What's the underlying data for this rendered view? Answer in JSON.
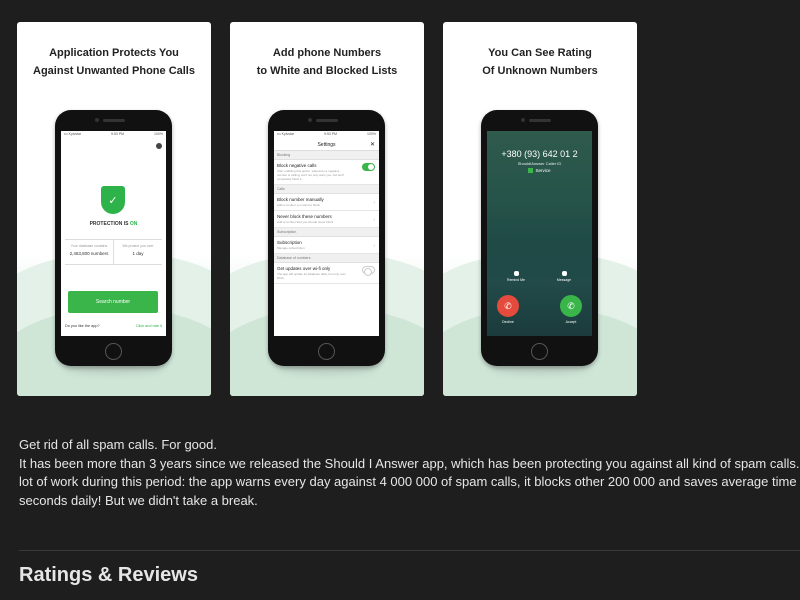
{
  "screenshots": [
    {
      "title_line1": "Application Protects You",
      "title_line2": "Against Unwanted Phone Calls",
      "status_left": "••• Kyivstar",
      "status_center": "9:53 PM",
      "status_right": "100%",
      "protection_label": "PROTECTION IS",
      "protection_state": "ON",
      "stat1_label": "Your database contains",
      "stat1_value": "2,463,800 numbers",
      "stat2_label": "We protect you over",
      "stat2_value": "1 day",
      "search_button": "Search number",
      "like_prompt": "Do you like the app?",
      "rate_link": "Click and rate it"
    },
    {
      "title_line1": "Add phone Numbers",
      "title_line2": "to White and Blocked Lists",
      "status_left": "••• Kyivstar",
      "status_center": "9:53 PM",
      "status_right": "100%",
      "nav_title": "Settings",
      "close": "✕",
      "sec_blocking": "Blocking",
      "block_negative": "Block negative calls",
      "block_negative_desc": "After enabling this option, whenever a negative number is calling, we'll not only warn you, but we'll completely block it.",
      "sec_calls": "Calls",
      "block_manual": "Block number manually",
      "block_manual_desc": "Add a number you want to block",
      "never_block": "Never block these numbers",
      "never_block_desc": "Add a number that you should never block",
      "sec_subscription": "Subscription",
      "subscription": "Subscription",
      "subscription_desc": "Manage subscription",
      "sec_database": "Database of numbers",
      "updates_wifi": "Get updates over wi-fi only",
      "updates_wifi_desc": "The app will update its database daily, but only over Wi-Fi"
    },
    {
      "title_line1": "You Can See Rating",
      "title_line2": "Of Unknown Numbers",
      "phone_number": "+380 (93) 642 01 2",
      "caller_id": "ShouldIAnswer Caller ID",
      "rating": "Service",
      "remind_me": "Remind Me",
      "message": "Message",
      "decline": "Decline",
      "accept": "Accept"
    }
  ],
  "description": {
    "line1": "Get rid of all spam calls. For good.",
    "line2": "It has been more than 3 years since we released the Should I Answer app, which has been protecting you against all kind of spam calls. We",
    "line3": "lot of work during this period: the app warns every day against 4 000 000 of spam calls, it blocks other 200 000 and saves average time of",
    "line4": "seconds daily! But we didn't take a break."
  },
  "ratings_heading": "Ratings & Reviews",
  "colors": {
    "background": "#1e1e1e",
    "accent_green": "#3ab54a",
    "decline_red": "#e54b3c"
  }
}
